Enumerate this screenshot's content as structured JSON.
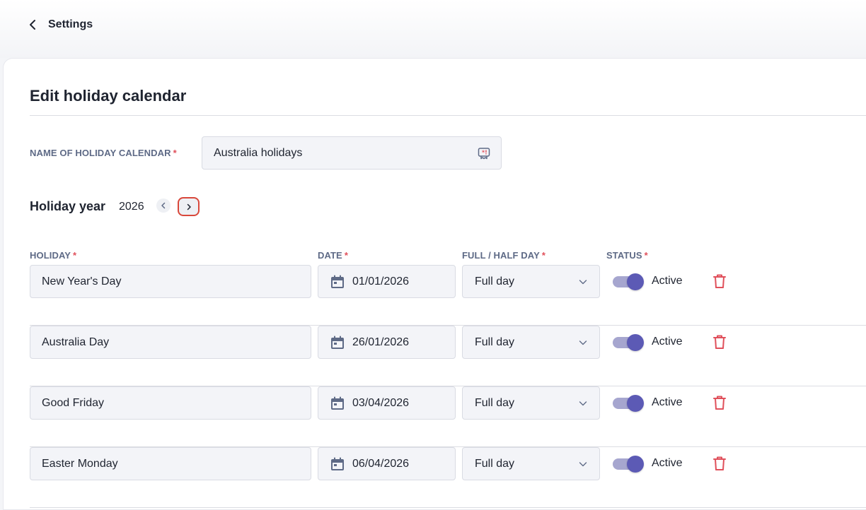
{
  "header": {
    "back_label": "Settings"
  },
  "page": {
    "title": "Edit holiday calendar"
  },
  "name_field": {
    "label": "NAME OF HOLIDAY CALENDAR",
    "required_mark": "*",
    "value": "Australia holidays"
  },
  "year": {
    "title": "Holiday year",
    "value": "2026"
  },
  "columns": {
    "holiday": "HOLIDAY",
    "date": "DATE",
    "type": "FULL / HALF DAY",
    "status": "STATUS",
    "required_mark": "*"
  },
  "holidays": [
    {
      "name": "New Year's Day",
      "date": "01/01/2026",
      "type": "Full day",
      "status": "Active"
    },
    {
      "name": "Australia Day",
      "date": "26/01/2026",
      "type": "Full day",
      "status": "Active"
    },
    {
      "name": "Good Friday",
      "date": "03/04/2026",
      "type": "Full day",
      "status": "Active"
    },
    {
      "name": "Easter Monday",
      "date": "06/04/2026",
      "type": "Full day",
      "status": "Active"
    }
  ],
  "colors": {
    "accent": "#5c5ab5",
    "danger": "#e0505b",
    "highlight": "#d9483b"
  },
  "icons": {
    "back": "chevron-left-icon",
    "name_field": "badge-icon",
    "year_prev": "chevron-left-icon",
    "year_next": "chevron-right-icon",
    "date": "calendar-icon",
    "type": "chevron-down-icon",
    "delete": "trash-icon"
  }
}
